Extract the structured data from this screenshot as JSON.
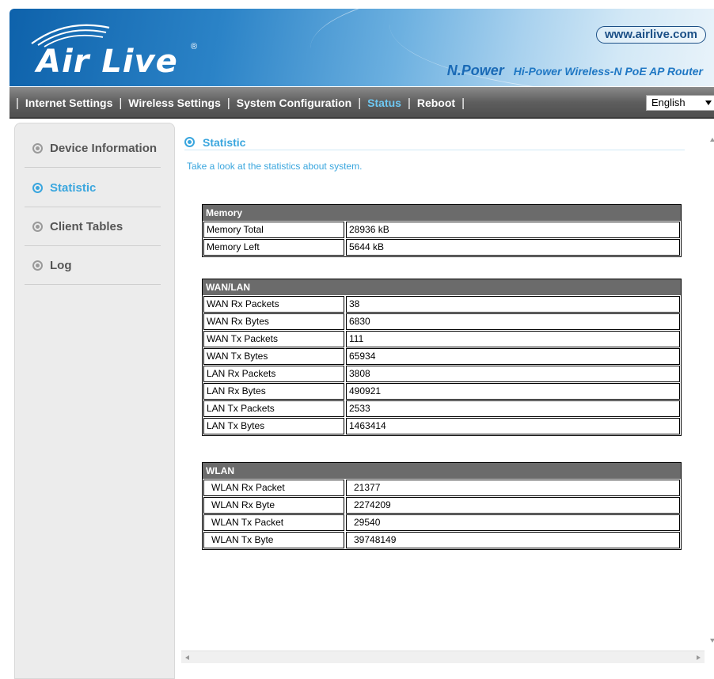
{
  "header": {
    "logo_text": "Air Live",
    "logo_mark": "®",
    "website": "www.airlive.com",
    "product_brand": "N.Power",
    "product_desc": "Hi-Power Wireless-N PoE AP Router"
  },
  "nav": {
    "items": [
      {
        "label": "Internet Settings"
      },
      {
        "label": "Wireless Settings"
      },
      {
        "label": "System Configuration"
      },
      {
        "label": "Status"
      },
      {
        "label": "Reboot"
      }
    ],
    "active": "Status",
    "language": "English"
  },
  "sidebar": {
    "items": [
      {
        "label": "Device Information"
      },
      {
        "label": "Statistic"
      },
      {
        "label": "Client Tables"
      },
      {
        "label": "Log"
      }
    ],
    "active": "Statistic"
  },
  "main": {
    "title": "Statistic",
    "description": "Take a look at the statistics about system.",
    "memory": {
      "header": "Memory",
      "rows": [
        {
          "label": "Memory Total",
          "value": "28936 kB"
        },
        {
          "label": "Memory Left",
          "value": "5644 kB"
        }
      ]
    },
    "wanlan": {
      "header": "WAN/LAN",
      "rows": [
        {
          "label": "WAN Rx Packets",
          "value": "38"
        },
        {
          "label": "WAN Rx Bytes",
          "value": "6830"
        },
        {
          "label": "WAN Tx Packets",
          "value": "111"
        },
        {
          "label": "WAN Tx Bytes",
          "value": "65934"
        },
        {
          "label": "LAN Rx Packets",
          "value": "3808"
        },
        {
          "label": "LAN Rx Bytes",
          "value": "490921"
        },
        {
          "label": "LAN Tx Packets",
          "value": "2533"
        },
        {
          "label": "LAN Tx Bytes",
          "value": "1463414"
        }
      ]
    },
    "wlan": {
      "header": "WLAN",
      "rows": [
        {
          "label": "WLAN Rx Packet",
          "value": "21377"
        },
        {
          "label": "WLAN Rx Byte",
          "value": "2274209"
        },
        {
          "label": "WLAN Tx Packet",
          "value": "29540"
        },
        {
          "label": "WLAN Tx Byte",
          "value": "39748149"
        }
      ]
    }
  },
  "colors": {
    "accent": "#3aa6de",
    "nav_bg": "#5e5e5e",
    "table_header_bg": "#6b6b6b",
    "sidebar_bg": "#ececec"
  }
}
